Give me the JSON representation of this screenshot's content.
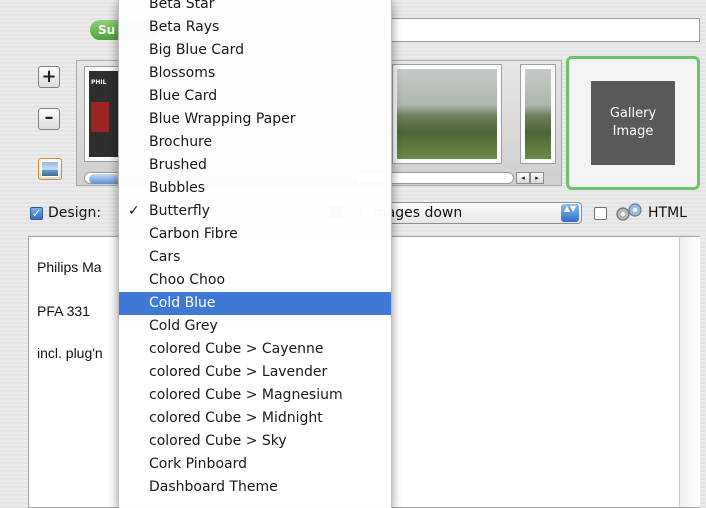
{
  "status_pill": "Su",
  "add_symbol": "+",
  "remove_symbol": "–",
  "thumbnail_brochure_text": "PHIL",
  "gallery_card": {
    "line1": "Gallery",
    "line2": "Image"
  },
  "scroll": {
    "left": "◂",
    "right": "▸"
  },
  "design_row": {
    "checkbox_checked": "✓",
    "label": "Design:",
    "order_value": "mages down",
    "arrow": "▲▼",
    "html_label": "HTML"
  },
  "description_lines": [
    "Philips Ma",
    "PFA 331",
    "incl. plug'n"
  ],
  "menu": {
    "check_glyph": "✓",
    "items": [
      {
        "label": "Beta Star",
        "checked": false,
        "highlighted": false
      },
      {
        "label": "Beta Rays",
        "checked": false,
        "highlighted": false
      },
      {
        "label": "Big Blue Card",
        "checked": false,
        "highlighted": false
      },
      {
        "label": "Blossoms",
        "checked": false,
        "highlighted": false
      },
      {
        "label": "Blue Card",
        "checked": false,
        "highlighted": false
      },
      {
        "label": "Blue Wrapping Paper",
        "checked": false,
        "highlighted": false
      },
      {
        "label": "Brochure",
        "checked": false,
        "highlighted": false
      },
      {
        "label": "Brushed",
        "checked": false,
        "highlighted": false
      },
      {
        "label": "Bubbles",
        "checked": false,
        "highlighted": false
      },
      {
        "label": "Butterfly",
        "checked": true,
        "highlighted": false
      },
      {
        "label": "Carbon Fibre",
        "checked": false,
        "highlighted": false
      },
      {
        "label": "Cars",
        "checked": false,
        "highlighted": false
      },
      {
        "label": "Choo Choo",
        "checked": false,
        "highlighted": false
      },
      {
        "label": "Cold Blue",
        "checked": false,
        "highlighted": true
      },
      {
        "label": "Cold Grey",
        "checked": false,
        "highlighted": false
      },
      {
        "label": "colored Cube > Cayenne",
        "checked": false,
        "highlighted": false
      },
      {
        "label": "colored Cube > Lavender",
        "checked": false,
        "highlighted": false
      },
      {
        "label": "colored Cube > Magnesium",
        "checked": false,
        "highlighted": false
      },
      {
        "label": "colored Cube > Midnight",
        "checked": false,
        "highlighted": false
      },
      {
        "label": "colored Cube > Sky",
        "checked": false,
        "highlighted": false
      },
      {
        "label": "Cork Pinboard",
        "checked": false,
        "highlighted": false
      },
      {
        "label": "Dashboard Theme",
        "checked": false,
        "highlighted": false
      }
    ]
  },
  "colors": {
    "selection": "#3875d7",
    "gallery_border": "#6bc46a",
    "status_green": "#4da43a"
  }
}
